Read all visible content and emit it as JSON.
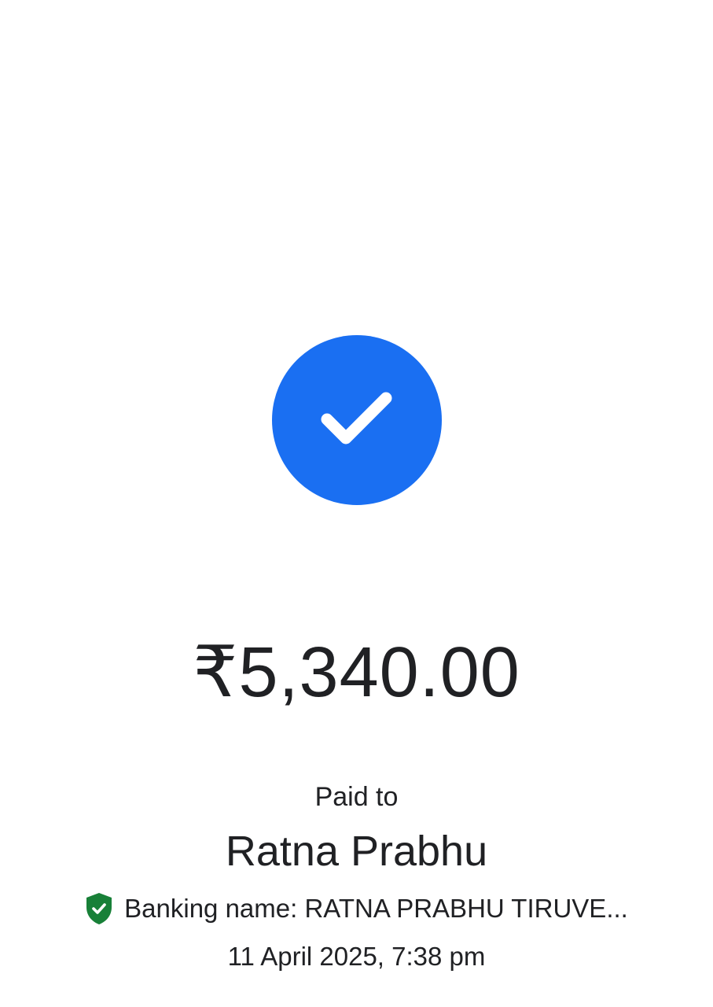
{
  "payment": {
    "status_icon": "check-icon",
    "amount": "₹5,340.00",
    "paid_to_label": "Paid to",
    "payee_name": "Ratna Prabhu",
    "banking_name": "Banking name: RATNA PRABHU TIRUVE...",
    "verified_icon": "verified-shield-icon",
    "datetime": "11 April 2025, 7:38 pm"
  },
  "colors": {
    "success_blue": "#1a6ff2",
    "verified_green": "#188038",
    "text": "#202124",
    "background": "#ffffff"
  }
}
